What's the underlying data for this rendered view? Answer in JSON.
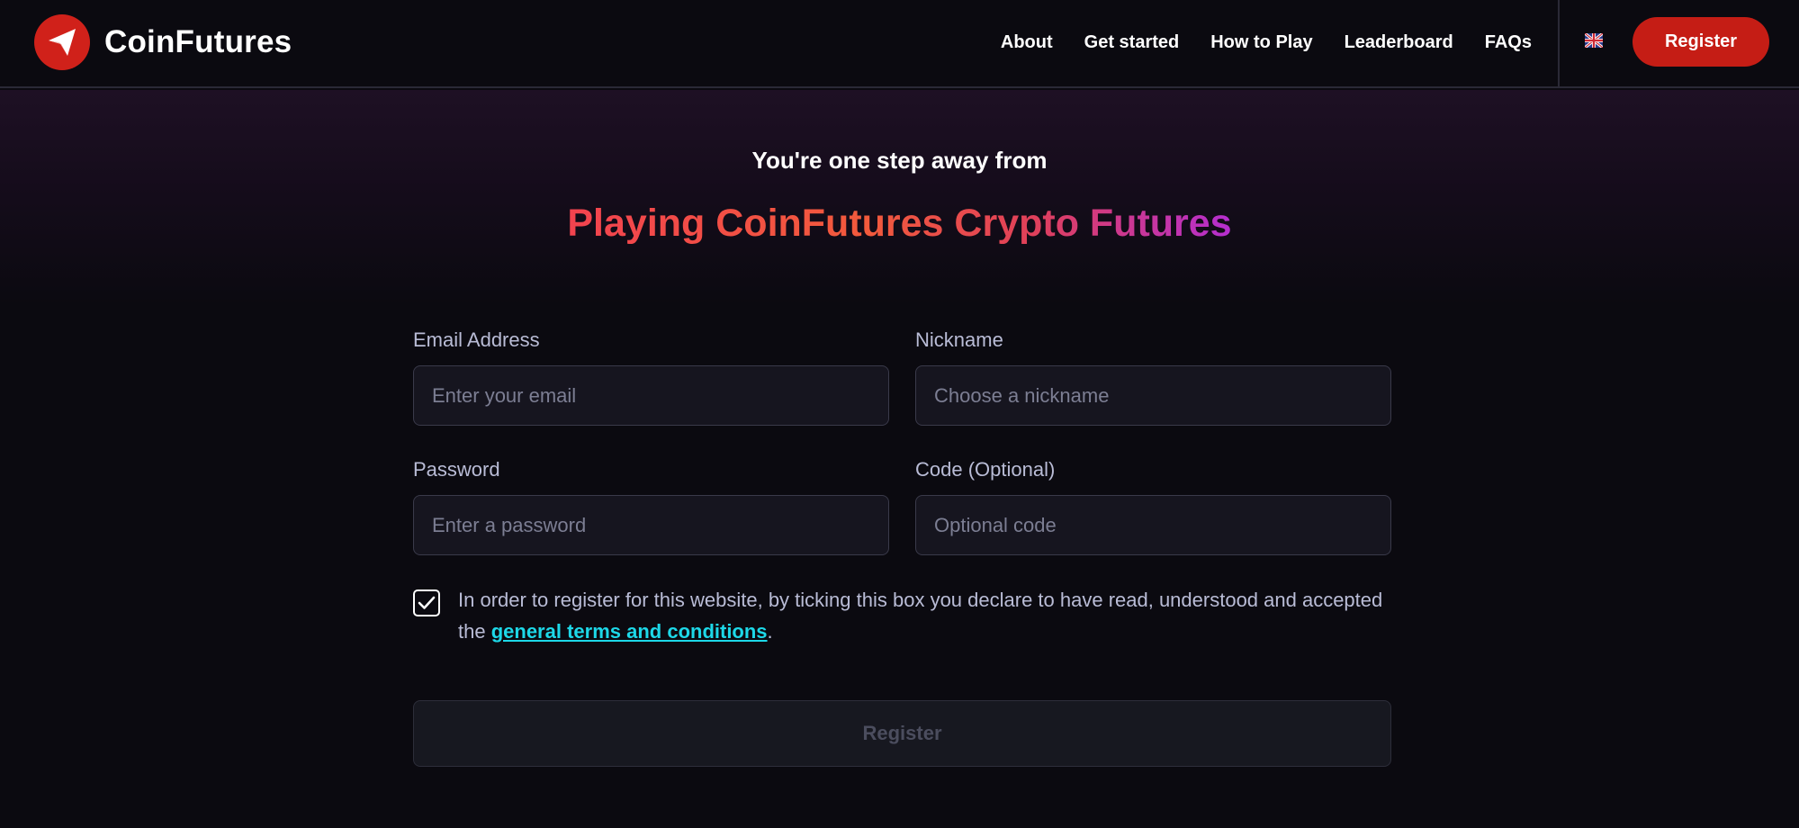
{
  "brand": {
    "name": "CoinFutures"
  },
  "nav": {
    "links": [
      "About",
      "Get started",
      "How to Play",
      "Leaderboard",
      "FAQs"
    ],
    "language_flag": "uk-flag-icon",
    "register_label": "Register"
  },
  "hero": {
    "subtitle": "You're one step away from",
    "headline": "Playing CoinFutures Crypto Futures"
  },
  "form": {
    "email": {
      "label": "Email Address",
      "placeholder": "Enter your email",
      "value": ""
    },
    "nickname": {
      "label": "Nickname",
      "placeholder": "Choose a nickname",
      "value": ""
    },
    "password": {
      "label": "Password",
      "placeholder": "Enter a password",
      "value": ""
    },
    "code": {
      "label": "Code (Optional)",
      "placeholder": "Optional code",
      "value": ""
    },
    "terms": {
      "checked": true,
      "text_before": "In order to register for this website, by ticking this box you declare to have read, understood and accepted the ",
      "link_text": "general terms and conditions",
      "text_after": "."
    },
    "submit_label": "Register"
  },
  "colors": {
    "accent_red": "#c51d15",
    "link_cyan": "#1dd8e8",
    "label_gray": "#b9bcd6",
    "background": "#0b0a10"
  }
}
